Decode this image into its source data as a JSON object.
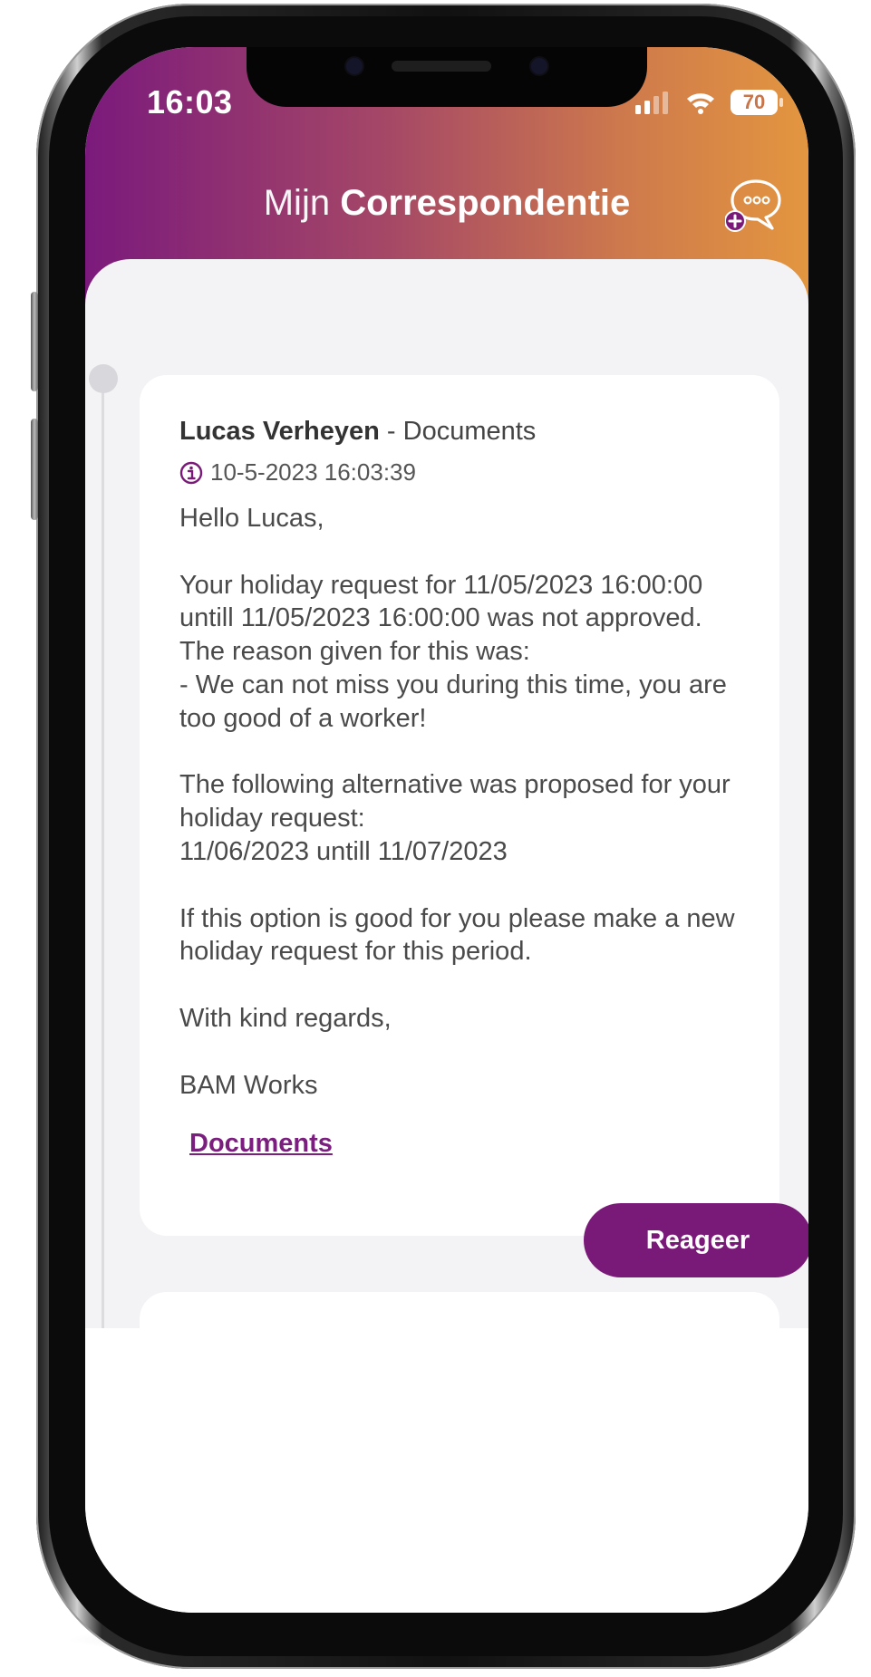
{
  "status_bar": {
    "time": "16:03",
    "battery": "70",
    "icons": [
      "signal-icon",
      "wifi-icon",
      "battery-icon"
    ]
  },
  "header": {
    "title_light": "Mijn",
    "title_bold": "Correspondentie",
    "action_icon": "chat-add-icon"
  },
  "message_card": {
    "sender": "Lucas Verheyen",
    "separator": " - ",
    "category": "Documents",
    "timestamp": "10-5-2023 16:03:39",
    "info_icon": "info-icon",
    "body": "Hello Lucas,\n\nYour holiday request for 11/05/2023 16:00:00 untill 11/05/2023 16:00:00 was not approved.\nThe reason given for this was:\n- We can not miss you during this time, you are too good of a worker!\n\nThe following alternative was proposed for your holiday request:\n11/06/2023 untill 11/07/2023\n\nIf this option is good for you please make a new holiday request for this period.\n\nWith kind regards,\n\nBAM Works",
    "link_label": "Documents",
    "reply_label": "Reageer"
  },
  "colors": {
    "brand_purple": "#7a1a78",
    "gradient_start": "#7b1a7c",
    "gradient_end": "#e3963f",
    "background": "#f3f3f5"
  }
}
